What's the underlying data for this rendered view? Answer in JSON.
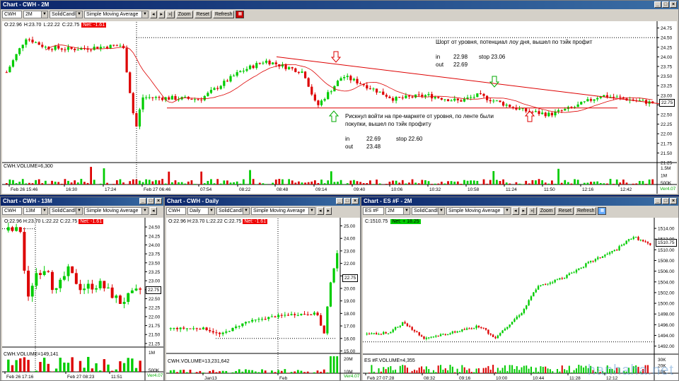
{
  "colors": {
    "up": "#00cc00",
    "down": "#dd0000",
    "sma": "#dd0000",
    "vol": "#00bb00",
    "title": "#0a246a",
    "net_red": "#ee0000",
    "net_green": "#00cc00"
  },
  "top": {
    "title": "Chart - CWH - 2M",
    "symbol": "CWH",
    "interval": "2M",
    "style": "SolidCandle",
    "study": "Simple Moving Average",
    "buttons": {
      "zoom": "Zoom",
      "reset": "Reset",
      "refresh": "Refresh"
    },
    "ohlc": {
      "o": "O:22.96",
      "h": "H:23.70",
      "l": "L:22.22",
      "c": "C:22.75",
      "net": "Net: -1.61"
    },
    "volume_label": "CWH.VOLUME=6,300",
    "price_label": "22.75",
    "y_ticks": [
      "24.75",
      "24.50",
      "24.25",
      "24.00",
      "23.75",
      "23.50",
      "23.25",
      "23.00",
      "22.75",
      "22.50",
      "22.25",
      "22.00",
      "21.75",
      "21.50",
      "21.25"
    ],
    "vol_ticks": [
      "1.5M",
      "1M",
      "500K"
    ],
    "x_ticks": [
      "Feb 26 15:46",
      "16:30",
      "17:24",
      "Feb 27 06:46",
      "07:54",
      "08:22",
      "08:48",
      "09:14",
      "09:40",
      "10:06",
      "10:32",
      "10:58",
      "11:24",
      "11:50",
      "12:16",
      "12:42"
    ],
    "version": "Ver4.07",
    "annotations": {
      "short_title": "Шорт от уровня, потенциал лоу дня, вышел по тэйк профит",
      "short_in": "in",
      "short_in_val": "22.98",
      "short_stop": "stop  23.06",
      "short_out": "out",
      "short_out_val": "22.69",
      "long_title1": "Рискнул войти на пре-маркете от уровня, по ленте были",
      "long_title2": "покупки, вышел по тэйк профиту",
      "long_in": "in",
      "long_in_val": "22.69",
      "long_stop": "stop 22.60",
      "long_out": "out",
      "long_out_val": "23.48"
    }
  },
  "bl": {
    "title": "Chart - CWH - 13M",
    "symbol": "CWH",
    "interval": "13M",
    "style": "SolidCandle",
    "study": "Simple Moving Average",
    "ohlc": {
      "o": "O:22.96",
      "h": "H:23.70",
      "l": "L:22.22",
      "c": "C:22.75",
      "net": "Net: -1.61"
    },
    "volume_label": "CWH.VOLUME=149,141",
    "price_label": "22.75",
    "y_ticks": [
      "24.50",
      "24.25",
      "24.00",
      "23.75",
      "23.50",
      "23.25",
      "23.00",
      "22.75",
      "22.50",
      "22.25",
      "22.00",
      "21.75",
      "21.50",
      "21.25"
    ],
    "vol_ticks": [
      "1M",
      "500K"
    ],
    "x_ticks": [
      "Feb 26 17:16",
      "Feb 27 08:23",
      "11:51"
    ],
    "version": "Ver4.07"
  },
  "bm": {
    "title": "Chart - CWH - Daily",
    "symbol": "CWH",
    "interval": "Daily",
    "style": "SolidCandle",
    "study": "Simple Moving Average",
    "ohlc": {
      "o": "O:22.96",
      "h": "H:23.70",
      "l": "L:22.22",
      "c": "C:22.75",
      "net": "Net: -1.61"
    },
    "volume_label": "CWH.VOLUME=13,231,642",
    "price_label": "22.75",
    "y_ticks": [
      "25.00",
      "24.00",
      "23.00",
      "22.00",
      "21.00",
      "20.00",
      "19.00",
      "18.00",
      "17.00",
      "16.00",
      "15.00"
    ],
    "vol_ticks": [
      "20M",
      "10M"
    ],
    "x_ticks": [
      "Jan13",
      "Feb"
    ],
    "version": "Ver4.07"
  },
  "br": {
    "title": "Chart - ES #F - 2M",
    "symbol": "ES #F",
    "interval": "2M",
    "style": "SolidCandle",
    "study": "Simple Moving Average",
    "buttons": {
      "zoom": "Zoom",
      "reset": "Reset",
      "refresh": "Refresh"
    },
    "ohlc": {
      "c": "C:1510.75",
      "net": "Net: + 18.25"
    },
    "volume_label": "ES #F.VOLUME=4,355",
    "price_label": "1510.75",
    "y_ticks": [
      "1514.00",
      "1512.00",
      "1510.00",
      "1508.00",
      "1506.00",
      "1504.00",
      "1502.00",
      "1500.00",
      "1498.00",
      "1496.00",
      "1494.00",
      "1492.00"
    ],
    "vol_ticks": [
      "30K",
      "20K",
      "10K"
    ],
    "x_ticks": [
      "Feb 27 07:28",
      "08:32",
      "09:16",
      "10:00",
      "10:44",
      "11:28",
      "12:12"
    ],
    "watermark": "hanhaha.net"
  }
}
